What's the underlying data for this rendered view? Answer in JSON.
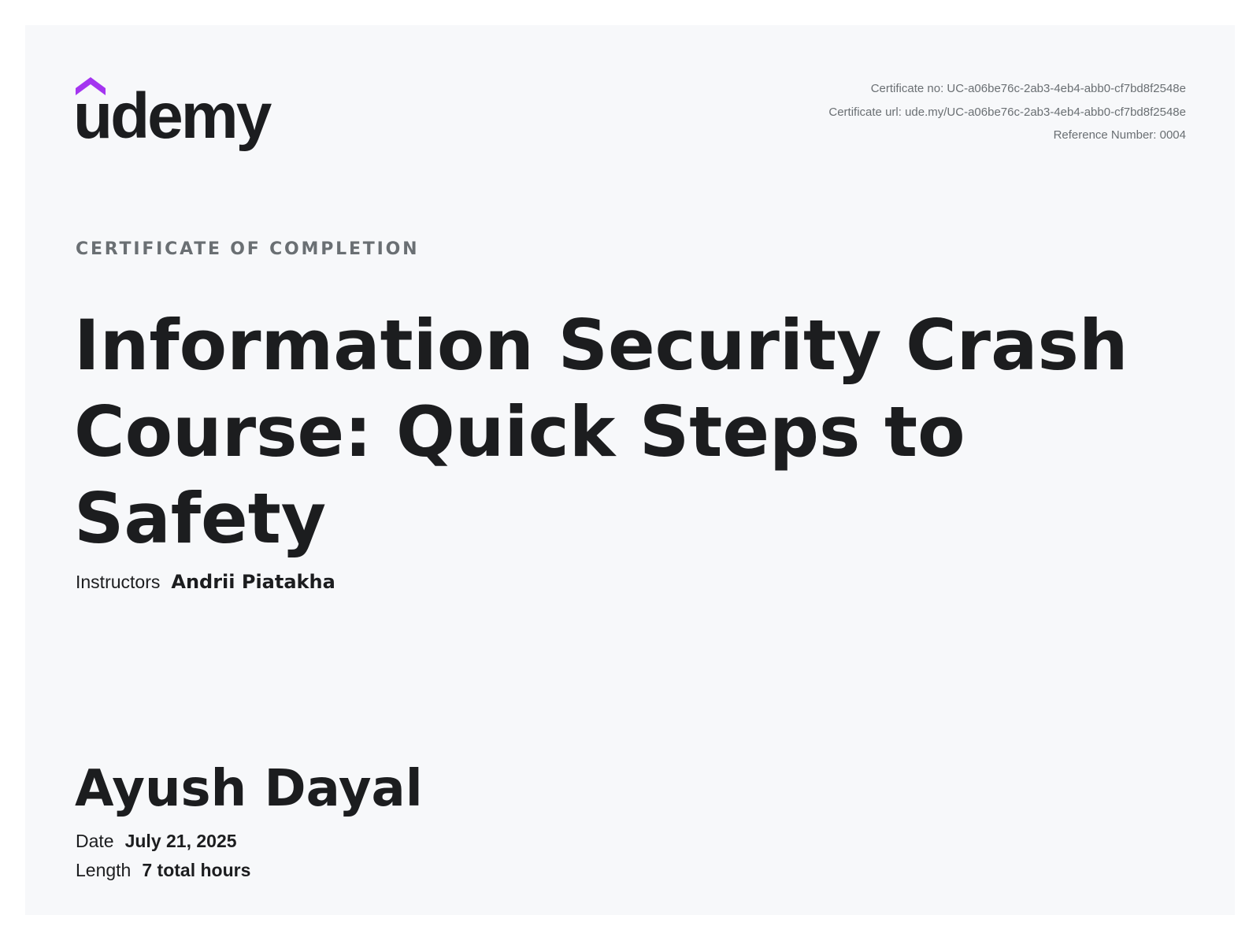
{
  "brand": {
    "name": "udemy",
    "accent_color": "#a435f0",
    "text_color": "#1c1d1f"
  },
  "meta": {
    "certificate_no": "Certificate no: UC-a06be76c-2ab3-4eb4-abb0-cf7bd8f2548e",
    "certificate_url": "Certificate url: ude.my/UC-a06be76c-2ab3-4eb4-abb0-cf7bd8f2548e",
    "reference_number": "Reference Number: 0004"
  },
  "certificate": {
    "label": "CERTIFICATE OF COMPLETION",
    "course_title": "Information Security Crash Course: Quick Steps to Safety",
    "instructors_label": "Instructors",
    "instructors_value": "Andrii Piatakha",
    "student_name": "Ayush Dayal",
    "date_label": "Date",
    "date_value": "July 21, 2025",
    "length_label": "Length",
    "length_value": "7 total hours"
  }
}
